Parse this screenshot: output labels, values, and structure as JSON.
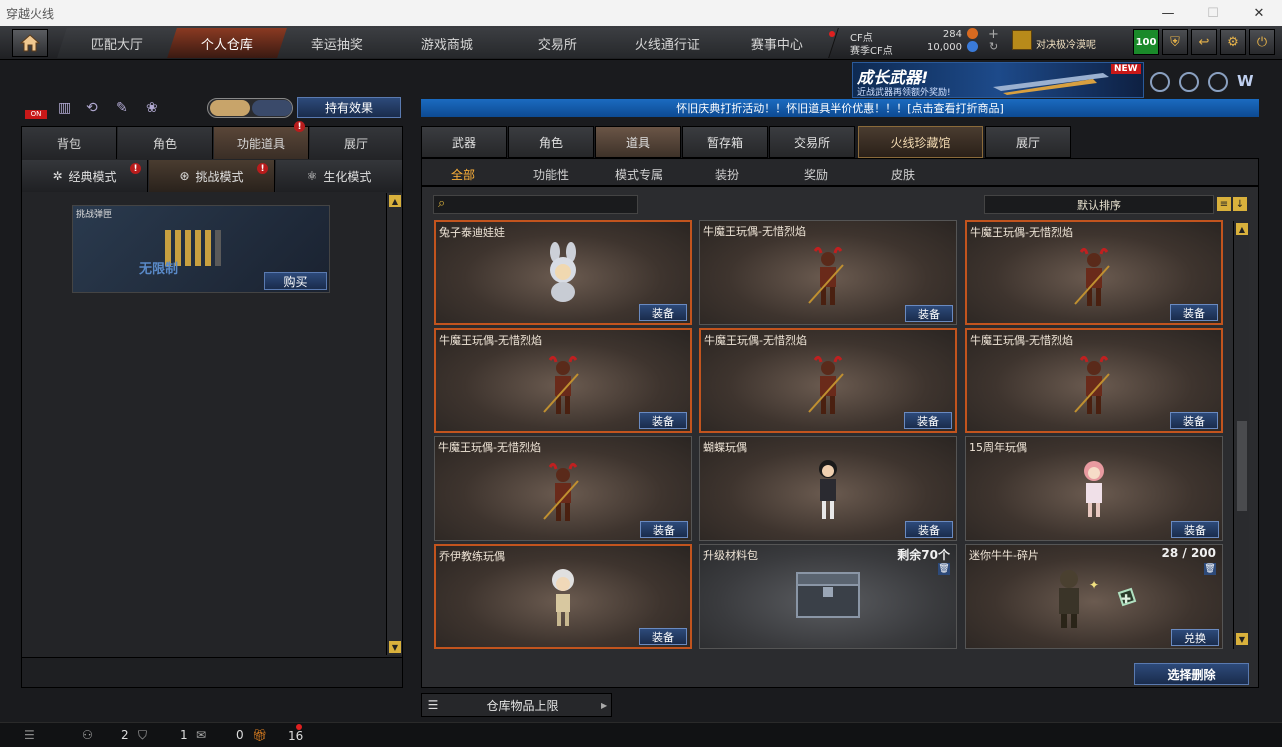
{
  "window": {
    "title": "穿越火线",
    "controls": [
      "—",
      "☐",
      "✕"
    ]
  },
  "nav": {
    "tabs": [
      "匹配大厅",
      "个人仓库",
      "幸运抽奖",
      "游戏商城",
      "交易所",
      "火线通行证",
      "赛事中心"
    ],
    "active": 1
  },
  "cf": {
    "cf_label": "CF点",
    "cf_value": "284",
    "season_label": "赛季CF点",
    "season_value": "10,000"
  },
  "event_label": "对决极冷漠呢",
  "level_badge": "100",
  "banner": {
    "title": "成长武器!",
    "subtitle": "近战武器再领额外奖励!",
    "tag": "NEW"
  },
  "left": {
    "toggle_on": "ON",
    "effects_button": "持有效果",
    "tabs": [
      "背包",
      "角色",
      "功能道具",
      "展厅"
    ],
    "active_tab": 2,
    "modes": [
      "经典模式",
      "挑战模式",
      "生化模式"
    ],
    "active_mode": 1,
    "challenge_card": {
      "title": "挑战弹匣",
      "overlay": "无限制",
      "buy": "购买"
    }
  },
  "notice": "怀旧庆典打折活动！！怀旧道具半价优惠！！！[点击查看打折商品]",
  "right": {
    "tabs": [
      "武器",
      "角色",
      "道具",
      "暂存箱",
      "交易所",
      "火线珍藏馆",
      "展厅"
    ],
    "active_tab": 2,
    "subtabs": [
      "全部",
      "功能性",
      "模式专属",
      "装扮",
      "奖励",
      "皮肤"
    ],
    "active_subtab": 0,
    "search_placeholder": "",
    "sort_label": "默认排序"
  },
  "items": [
    {
      "name": "兔子泰迪娃娃",
      "button": "装备",
      "highlight": true,
      "figure": "bunny-figure-icon"
    },
    {
      "name": "牛魔王玩偶-无惜烈焰",
      "button": "装备",
      "highlight": false,
      "figure": "bull-demon-figure-icon"
    },
    {
      "name": "牛魔王玩偶-无惜烈焰",
      "button": "装备",
      "highlight": true,
      "figure": "bull-demon-figure-icon"
    },
    {
      "name": "牛魔王玩偶-无惜烈焰",
      "button": "装备",
      "highlight": true,
      "figure": "bull-demon-figure-icon"
    },
    {
      "name": "牛魔王玩偶-无惜烈焰",
      "button": "装备",
      "highlight": true,
      "figure": "bull-demon-figure-icon"
    },
    {
      "name": "牛魔王玩偶-无惜烈焰",
      "button": "装备",
      "highlight": true,
      "figure": "bull-demon-figure-icon"
    },
    {
      "name": "牛魔王玩偶-无惜烈焰",
      "button": "装备",
      "highlight": false,
      "figure": "bull-demon-figure-icon"
    },
    {
      "name": "蝴蝶玩偶",
      "button": "装备",
      "highlight": false,
      "figure": "butterfly-doll-icon"
    },
    {
      "name": "15周年玩偶",
      "button": "装备",
      "highlight": false,
      "figure": "anniversary-doll-icon"
    },
    {
      "name": "乔伊教练玩偶",
      "button": "装备",
      "highlight": true,
      "figure": "coach-doll-icon"
    },
    {
      "name": "升级材料包",
      "extra": "剩余70个",
      "button": "",
      "highlight": false,
      "figure": "material-crate-icon"
    },
    {
      "name": "迷你牛牛-碎片",
      "extra": "28 / 200",
      "button": "兑换",
      "highlight": false,
      "figure": "mini-bull-shard-icon"
    }
  ],
  "select_delete": "选择删除",
  "storage_limit": "仓库物品上限",
  "bottom": {
    "c1": "2",
    "c2": "1",
    "c3": "0",
    "c4": "16"
  }
}
